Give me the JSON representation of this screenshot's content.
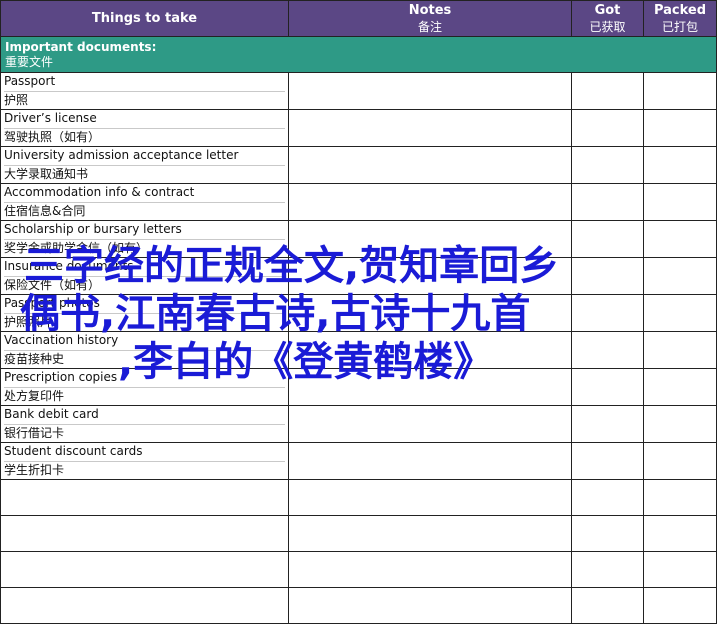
{
  "header": {
    "things_to_take": "Things to take",
    "notes_en": "Notes",
    "notes_zh": "备注",
    "got_en": "Got",
    "got_zh": "已获取",
    "packed_en": "Packed",
    "packed_zh": "已打包"
  },
  "section": {
    "title_en": "Important documents:",
    "title_zh": "重要文件"
  },
  "items": [
    {
      "en": "Passport",
      "zh": "护照"
    },
    {
      "en": "Driver’s license",
      "zh": "驾驶执照（如有）"
    },
    {
      "en": "University admission acceptance letter",
      "zh": "大学录取通知书"
    },
    {
      "en": "Accommodation info & contract",
      "zh": "住宿信息&合同"
    },
    {
      "en": "Scholarship or bursary letters",
      "zh": "奖学金或助学金信（如有）"
    },
    {
      "en": "Insurance documents",
      "zh": "保险文件（如有）"
    },
    {
      "en": "Passport photos",
      "zh": "护照照片"
    },
    {
      "en": "Vaccination history",
      "zh": "疫苗接种史"
    },
    {
      "en": "Prescription copies",
      "zh": "处方复印件"
    },
    {
      "en": "Bank debit card",
      "zh": "银行借记卡"
    },
    {
      "en": "Student discount cards",
      "zh": "学生折扣卡"
    }
  ],
  "overlay": {
    "line1": "三字经的正规全文,贺知章回乡",
    "line2": "偶书,江南春古诗,古诗十九首",
    "line3": ",李白的《登黄鹤楼》"
  },
  "colors": {
    "header_bg": "#5b4785",
    "section_bg": "#2e9a86",
    "overlay_text": "#1a1bd6"
  }
}
